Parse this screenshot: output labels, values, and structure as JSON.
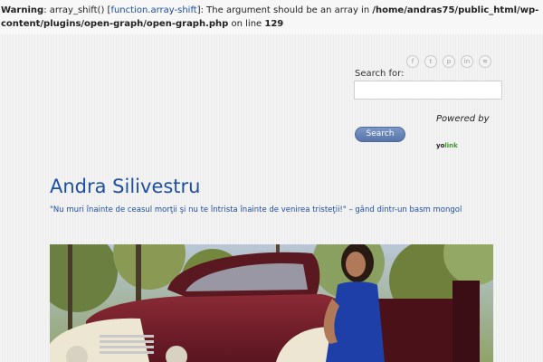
{
  "warning": {
    "label": "Warning",
    "text_1": ": array_shift() [",
    "link": "function.array-shift",
    "text_2": "]: The argument should be an array in ",
    "path": "/home/andras75/public_html/wp-content/plugins/open-graph/open-graph.php",
    "text_3": " on line ",
    "line": "129"
  },
  "social": [
    {
      "icon": "facebook-icon",
      "glyph": "f"
    },
    {
      "icon": "twitter-icon",
      "glyph": "t"
    },
    {
      "icon": "pinterest-icon",
      "glyph": "p"
    },
    {
      "icon": "linkedin-icon",
      "glyph": "in"
    },
    {
      "icon": "rss-icon",
      "glyph": "≋"
    }
  ],
  "search": {
    "label": "Search for:",
    "value": "",
    "button": "Search"
  },
  "powered": {
    "text": "Powered by",
    "brand_a": "yo",
    "brand_b": "link"
  },
  "site": {
    "title": "Andra Silivestru",
    "tagline": "\"Nu muri înainte de ceasul morţii şi nu te întrista înainte de venirea tristeţii!\" – gând dintr-un basm mongol"
  },
  "colors": {
    "link": "#1e4fa3",
    "button": "#6886b9",
    "yolink_green": "#3a9a2a"
  }
}
